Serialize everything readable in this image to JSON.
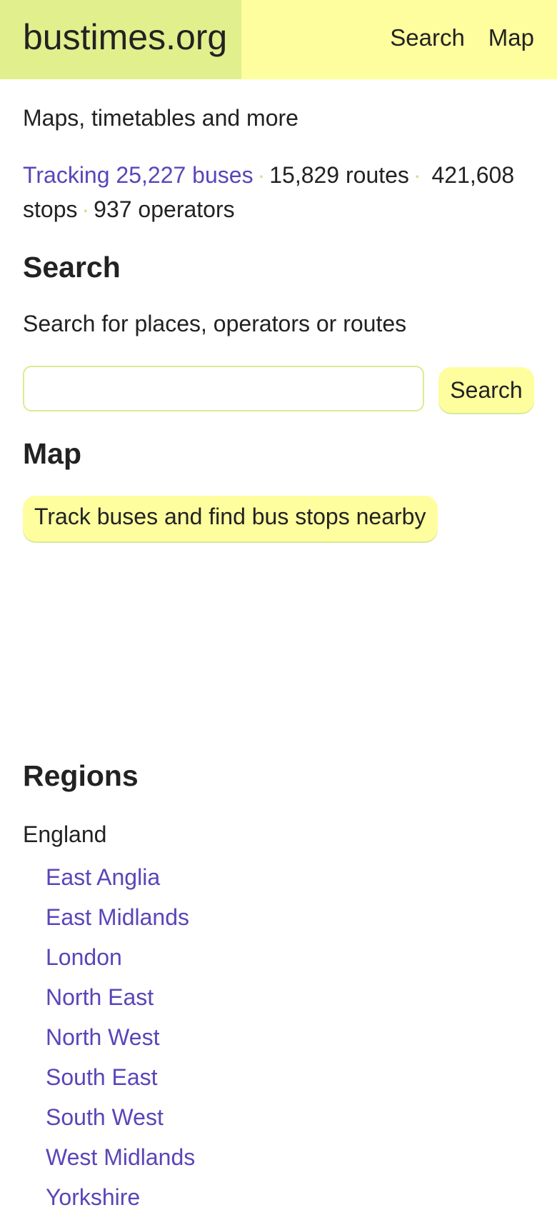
{
  "header": {
    "logo": "bustimes.org",
    "nav": [
      "Search",
      "Map"
    ]
  },
  "intro": {
    "tagline": "Maps, timetables and more",
    "tracking_link": "Tracking 25,227 buses",
    "routes": "15,829 routes",
    "stops": "421,608 stops",
    "operators": "937 operators",
    "separator": "·"
  },
  "search": {
    "heading": "Search",
    "description": "Search for places, operators or routes",
    "input_value": "",
    "button_label": "Search"
  },
  "map": {
    "heading": "Map",
    "button_label": "Track buses and find bus stops nearby"
  },
  "regions": {
    "heading": "Regions",
    "country": "England",
    "items": [
      "East Anglia",
      "East Midlands",
      "London",
      "North East",
      "North West",
      "South East",
      "South West",
      "West Midlands",
      "Yorkshire"
    ]
  },
  "colors": {
    "header_bg": "#fefe9e",
    "logo_bg": "#e1ef8d",
    "link": "#5b45b8",
    "text": "#222222"
  }
}
